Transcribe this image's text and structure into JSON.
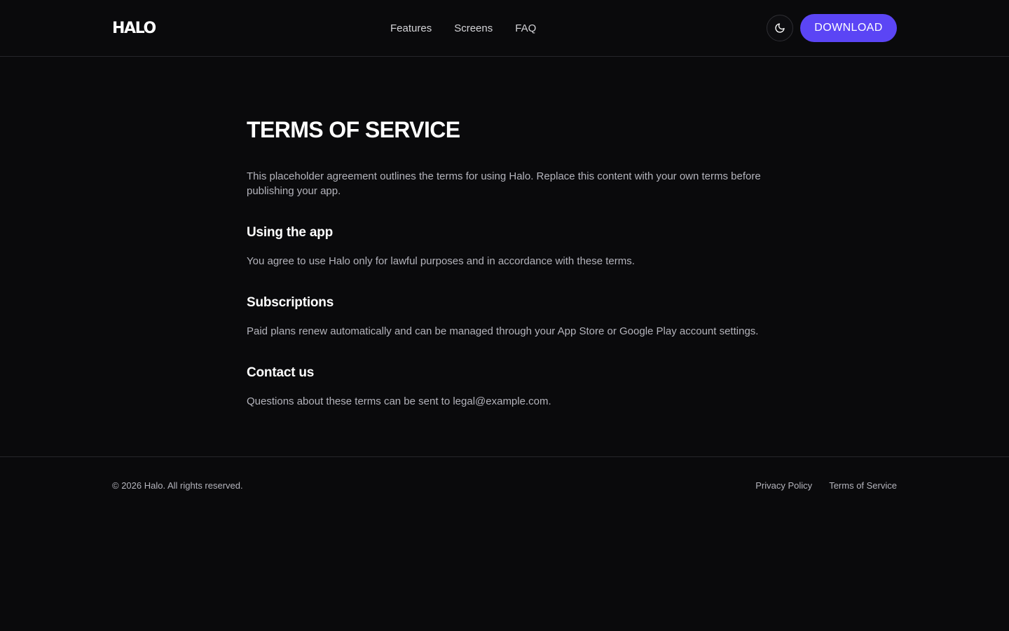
{
  "header": {
    "logo": "HALO",
    "nav": [
      "Features",
      "Screens",
      "FAQ"
    ],
    "theme_icon": "moon-icon",
    "download_label": "DOWNLOAD"
  },
  "content": {
    "title": "TERMS OF SERVICE",
    "intro": "This placeholder agreement outlines the terms for using Halo. Replace this content with your own terms before publishing your app.",
    "sections": [
      {
        "heading": "Using the app",
        "body": "You agree to use Halo only for lawful purposes and in accordance with these terms."
      },
      {
        "heading": "Subscriptions",
        "body": "Paid plans renew automatically and can be managed through your App Store or Google Play account settings."
      },
      {
        "heading": "Contact us",
        "body": "Questions about these terms can be sent to legal@example.com."
      }
    ]
  },
  "footer": {
    "copyright": "© 2026 Halo. All rights reserved.",
    "links": [
      "Privacy Policy",
      "Terms of Service"
    ]
  },
  "colors": {
    "background": "#0a0a0c",
    "accent": "#5b45f5",
    "muted_text": "#b4b4bc"
  }
}
